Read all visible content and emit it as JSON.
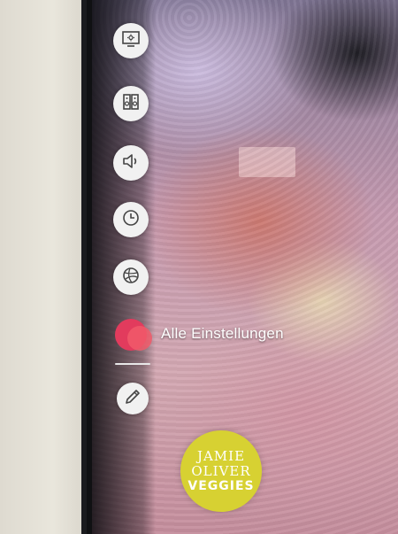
{
  "settings_menu": {
    "items": [
      {
        "icon": "picture-mode-icon"
      },
      {
        "icon": "speaker-icon"
      },
      {
        "icon": "sound-icon"
      },
      {
        "icon": "timer-clock-icon"
      },
      {
        "icon": "network-globe-icon"
      }
    ],
    "all_settings": {
      "label": "Alle Einstellungen",
      "icon": "all-settings-icon",
      "color": "#e23b5d"
    },
    "edit": {
      "icon": "edit-pencil-icon"
    }
  },
  "background": {
    "logo_lines": [
      "JAMIE",
      "OLIVER",
      "VEGGIES"
    ],
    "logo_color": "#d7d132"
  }
}
